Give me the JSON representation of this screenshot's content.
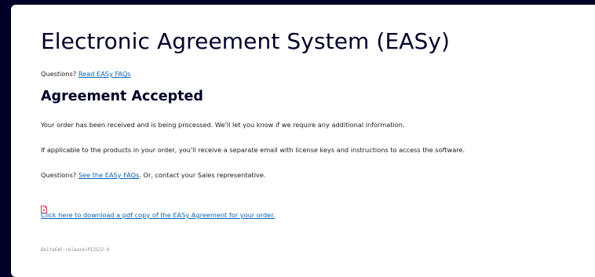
{
  "header": {
    "title": "Electronic Agreement System (EASy)",
    "questions_prefix": "Questions?",
    "faq_link": "Read EASy FAQs"
  },
  "confirmation": {
    "heading": "Agreement Accepted",
    "received_text": "Your order has been received and is being processed. We'll let you know if we require any additional information.",
    "license_text": "If applicable to the products in your order, you'll receive a separate email with license keys and instructions to access the software.",
    "questions_prefix": "Questions?",
    "faq_link": "See the EASy FAQs",
    "contact_suffix": ". Or, contact your Sales representative.",
    "pdf_icon": "pdf-file-icon",
    "pdf_link": "Click here to download a pdf copy of the EASy Agreement for your order."
  },
  "footer": {
    "build": "DeltaEAS-release/PI2512-4"
  },
  "colors": {
    "background": "#000028",
    "heading": "#000028",
    "link": "#0a63b8",
    "pdf_icon": "#d9001e"
  }
}
